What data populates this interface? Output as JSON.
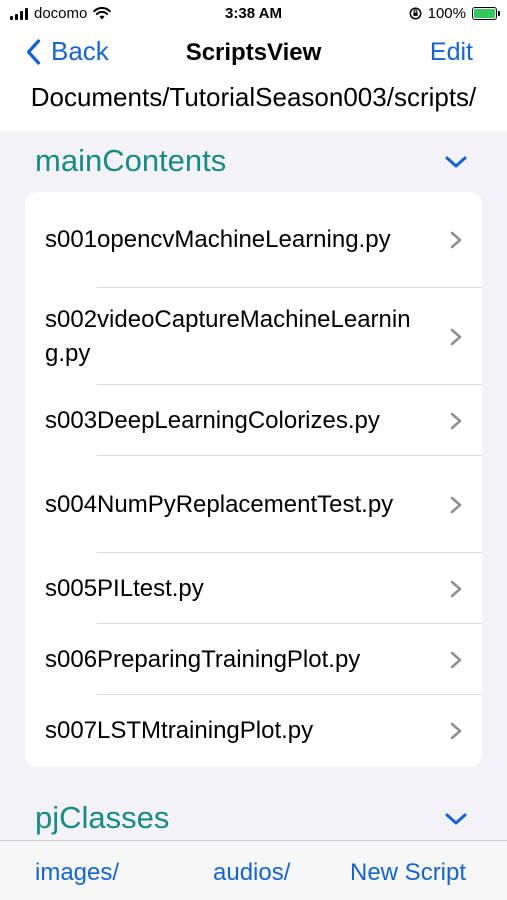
{
  "status_bar": {
    "carrier": "docomo",
    "time": "3:38 AM",
    "battery": "100%",
    "battery_level": 1.0
  },
  "nav": {
    "back_label": "Back",
    "title": "ScriptsView",
    "edit_label": "Edit"
  },
  "path": "Documents/TutorialSeason003/scripts/",
  "sections": [
    {
      "title": "mainContents",
      "items": [
        {
          "label": "s001opencvMachineLearning.py"
        },
        {
          "label": "s002videoCaptureMachineLearning.py"
        },
        {
          "label": "s003DeepLearningColorizes.py"
        },
        {
          "label": "s004NumPyReplacementTest.py"
        },
        {
          "label": "s005PILtest.py"
        },
        {
          "label": "s006PreparingTrainingPlot.py"
        },
        {
          "label": "s007LSTMtrainingPlot.py"
        }
      ]
    },
    {
      "title": "pjClasses",
      "items": []
    }
  ],
  "tab_bar": {
    "images_label": "images/",
    "audios_label": "audios/",
    "new_script_label": "New Script"
  },
  "colors": {
    "accent": "#1464d2",
    "section_title": "#1a8a86",
    "background": "#f2f2f7",
    "battery": "#34c759"
  }
}
